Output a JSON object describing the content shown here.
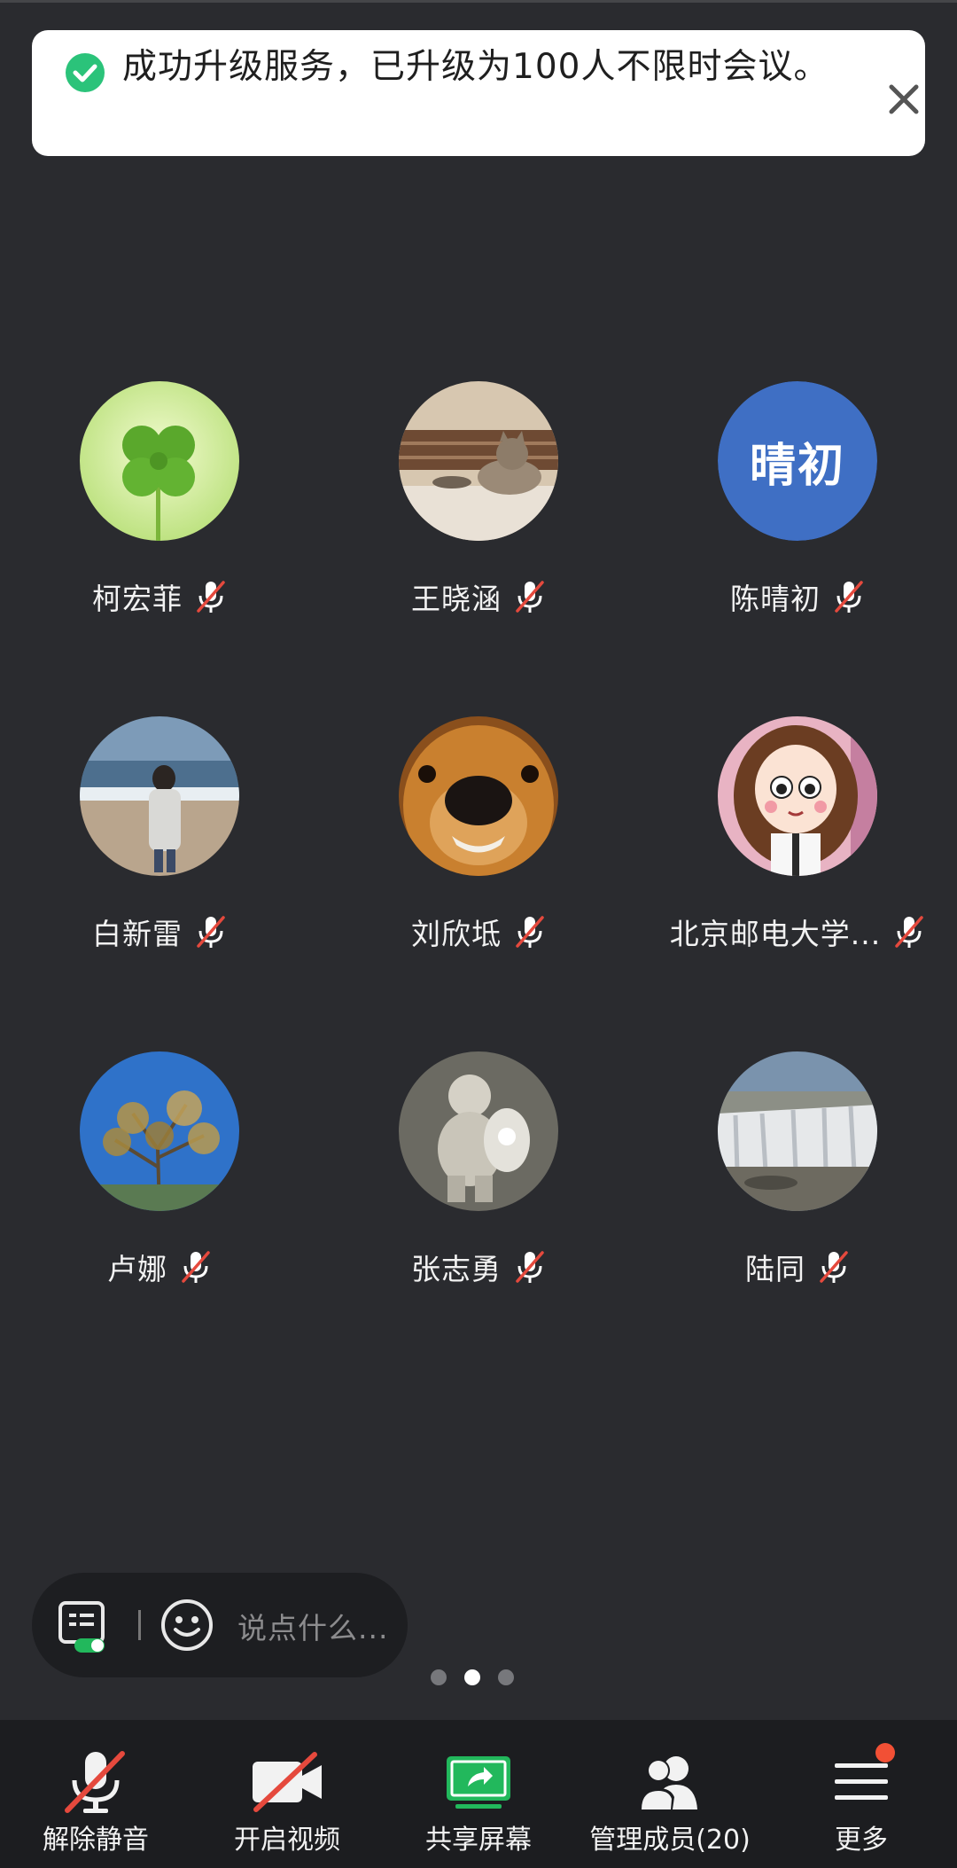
{
  "toast": {
    "message": "成功升级服务，已升级为100人不限时会议。",
    "icon": "check-circle-icon",
    "close_icon": "close-icon",
    "accent_color": "#2bc37a"
  },
  "participants": [
    {
      "name": "柯宏菲",
      "avatar": "clover-photo",
      "muted": true
    },
    {
      "name": "王晓涵",
      "avatar": "cat-photo",
      "muted": true
    },
    {
      "name": "陈晴初",
      "avatar_initials": "晴初",
      "muted": true
    },
    {
      "name": "白新雷",
      "avatar": "beach-photo",
      "muted": true
    },
    {
      "name": "刘欣坻",
      "avatar": "dog-photo",
      "muted": true
    },
    {
      "name": "北京邮电大学...",
      "avatar": "cartoon-girl",
      "muted": true
    },
    {
      "name": "卢娜",
      "avatar": "tree-sky-photo",
      "muted": true
    },
    {
      "name": "张志勇",
      "avatar": "baby-photo",
      "muted": true
    },
    {
      "name": "陆同",
      "avatar": "waterfall-photo",
      "muted": true
    }
  ],
  "chat": {
    "placeholder": "说点什么...",
    "icons": [
      "chat-icon",
      "emoji-icon"
    ]
  },
  "pagination": {
    "total": 3,
    "active": 1
  },
  "toolbar": {
    "unmute": "解除静音",
    "video": "开启视频",
    "share": "共享屏幕",
    "members": "管理成员(20)",
    "more": "更多"
  },
  "colors": {
    "background": "#2a2b2f",
    "toolbar": "#1c1d20",
    "share_green": "#22b85c",
    "muted_red": "#e5493d",
    "badge": "#f25035"
  }
}
